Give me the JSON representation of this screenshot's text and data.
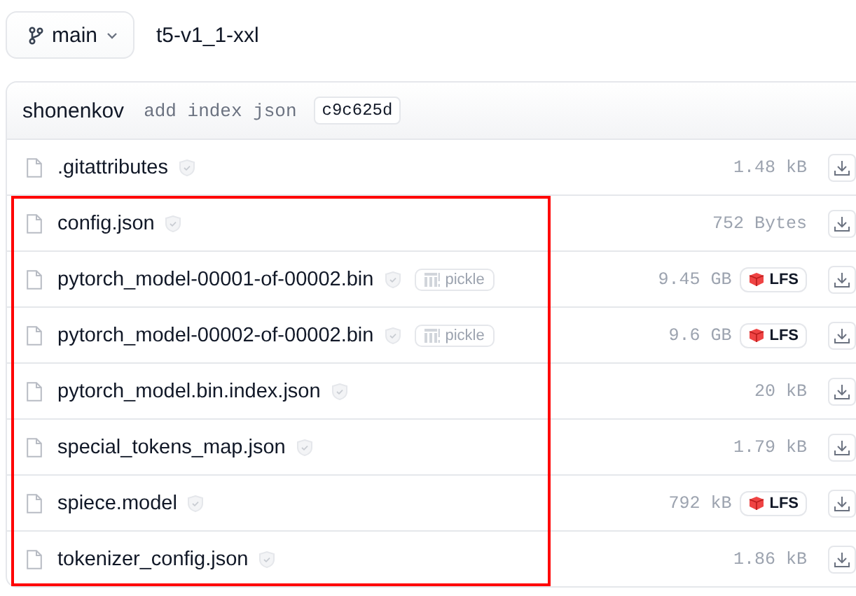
{
  "branch": {
    "label": "main"
  },
  "repo_name": "t5-v1_1-xxl",
  "commit": {
    "author": "shonenkov",
    "message": "add index json",
    "hash": "c9c625d"
  },
  "files": [
    {
      "name": ".gitattributes",
      "size": "1.48 kB",
      "highlighted": false
    },
    {
      "name": "config.json",
      "size": "752 Bytes",
      "highlighted": true
    },
    {
      "name": "pytorch_model-00001-of-00002.bin",
      "pickle_label": "pickle",
      "size": "9.45 GB",
      "lfs_label": "LFS",
      "highlighted": true
    },
    {
      "name": "pytorch_model-00002-of-00002.bin",
      "pickle_label": "pickle",
      "size": "9.6 GB",
      "lfs_label": "LFS",
      "highlighted": true
    },
    {
      "name": "pytorch_model.bin.index.json",
      "size": "20 kB",
      "highlighted": true
    },
    {
      "name": "special_tokens_map.json",
      "size": "1.79 kB",
      "highlighted": true
    },
    {
      "name": "spiece.model",
      "size": "792 kB",
      "lfs_label": "LFS",
      "highlighted": true
    },
    {
      "name": "tokenizer_config.json",
      "size": "1.86 kB",
      "highlighted": true
    }
  ]
}
